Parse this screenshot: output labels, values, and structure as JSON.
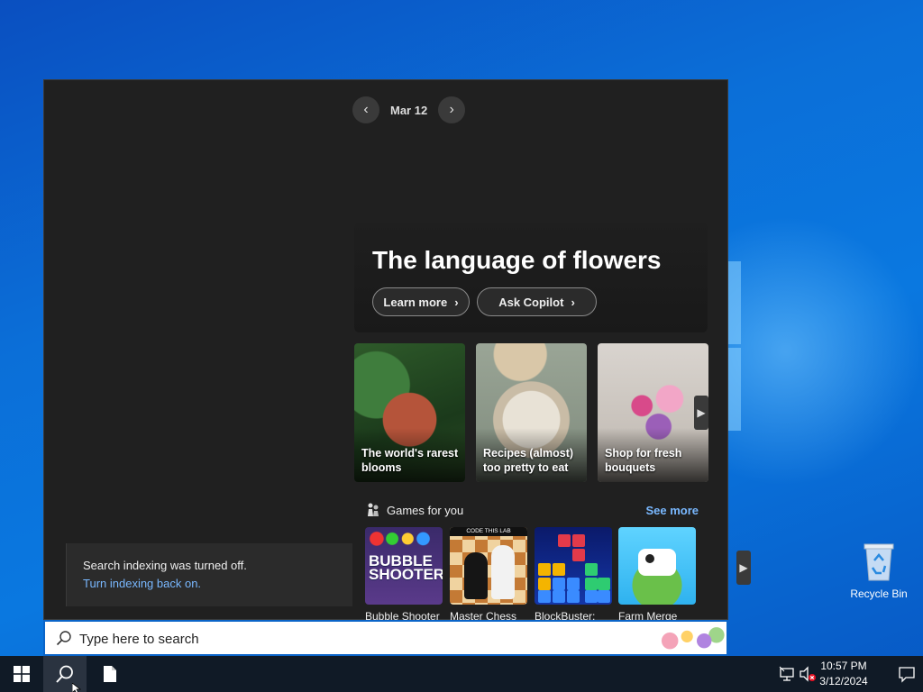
{
  "desktop": {
    "recycle_bin_label": "Recycle Bin"
  },
  "panel": {
    "date_label": "Mar 12",
    "hero": {
      "title": "The language of flowers",
      "learn_more": "Learn more",
      "ask_copilot": "Ask Copilot"
    },
    "cards": [
      {
        "caption_line1": "The world's rarest",
        "caption_line2": "blooms"
      },
      {
        "caption_line1": "Recipes (almost)",
        "caption_line2": "too pretty to eat"
      },
      {
        "caption_line1": "Shop for fresh",
        "caption_line2": "bouquets"
      }
    ],
    "games": {
      "heading": "Games for you",
      "see_more": "See more",
      "items": [
        {
          "name": "Bubble Shooter",
          "tile_text": "BUBBLE SHOOTER"
        },
        {
          "name": "Master Chess",
          "tile_text": "CODE THIS LAB"
        },
        {
          "name": "BlockBuster:"
        },
        {
          "name": "Farm Merge"
        }
      ]
    },
    "notice": {
      "message": "Search indexing was turned off.",
      "link": "Turn indexing back on."
    }
  },
  "search": {
    "placeholder": "Type here to search"
  },
  "taskbar": {
    "time": "10:57 PM",
    "date": "3/12/2024"
  },
  "colors": {
    "panel_bg": "#202020",
    "link": "#79b8ff",
    "taskbar_bg": "#101a26",
    "accent": "#0a64c8"
  }
}
